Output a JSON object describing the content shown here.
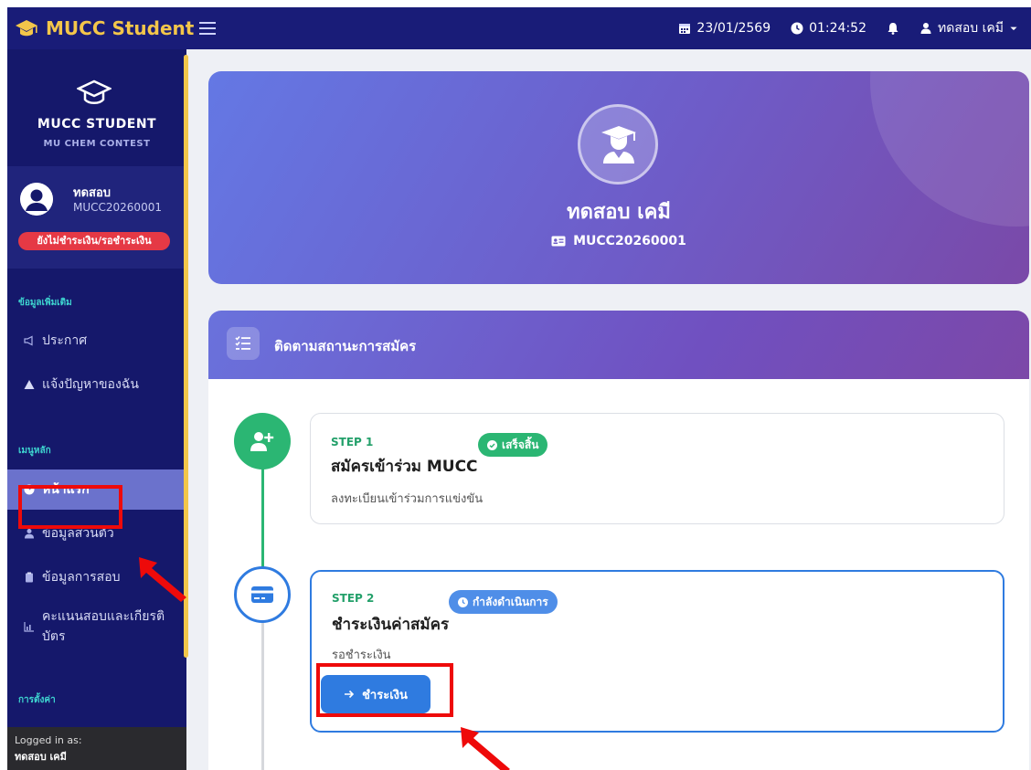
{
  "topbar": {
    "brand": "MUCC Student",
    "date": "23/01/2569",
    "time": "01:24:52",
    "user": "ทดสอบ เคมี"
  },
  "sidebar": {
    "title": "MUCC STUDENT",
    "subtitle": "MU CHEM CONTEST",
    "user_name": "ทดสอบ",
    "user_id": "MUCC20260001",
    "status": "ยังไม่ชำระเงิน/รอชำระเงิน",
    "section_info": "ข้อมูลเพิ่มเติม",
    "items_info": [
      {
        "label": "ประกาศ",
        "icon": "megaphone-icon"
      },
      {
        "label": "แจ้งปัญหาของฉัน",
        "icon": "warning-icon"
      }
    ],
    "section_main": "เมนูหลัก",
    "items_main": [
      {
        "label": "หน้าแรก",
        "icon": "dashboard-icon"
      },
      {
        "label": "ข้อมูลส่วนตัว",
        "icon": "user-icon"
      },
      {
        "label": "ข้อมูลการสอบ",
        "icon": "clipboard-icon"
      },
      {
        "label": "คะแนนสอบและเกียรติบัตร",
        "icon": "chart-icon"
      }
    ],
    "section_settings": "การตั้งค่า",
    "footer_label": "Logged in as:",
    "footer_user": "ทดสอบ เคมี"
  },
  "hero": {
    "name": "ทดสอบ เคมี",
    "student_id": "MUCC20260001"
  },
  "tracker": {
    "title": "ติดตามสถานะการสมัคร",
    "steps": [
      {
        "label": "STEP 1",
        "title": "สมัครเข้าร่วม MUCC",
        "description": "ลงทะเบียนเข้าร่วมการแข่งขัน",
        "badge": "เสร็จสิ้น"
      },
      {
        "label": "STEP 2",
        "title": "ชำระเงินค่าสมัคร",
        "description": "รอชำระเงิน",
        "badge": "กำลังดำเนินการ",
        "button": "ชำระเงิน"
      }
    ]
  },
  "colors": {
    "topbar": "#191c78",
    "sidebar": "#15186b",
    "accent_gold": "#f3c64a",
    "success": "#2bb673",
    "primary": "#2f7be0",
    "annotation": "#ee0a0a"
  }
}
